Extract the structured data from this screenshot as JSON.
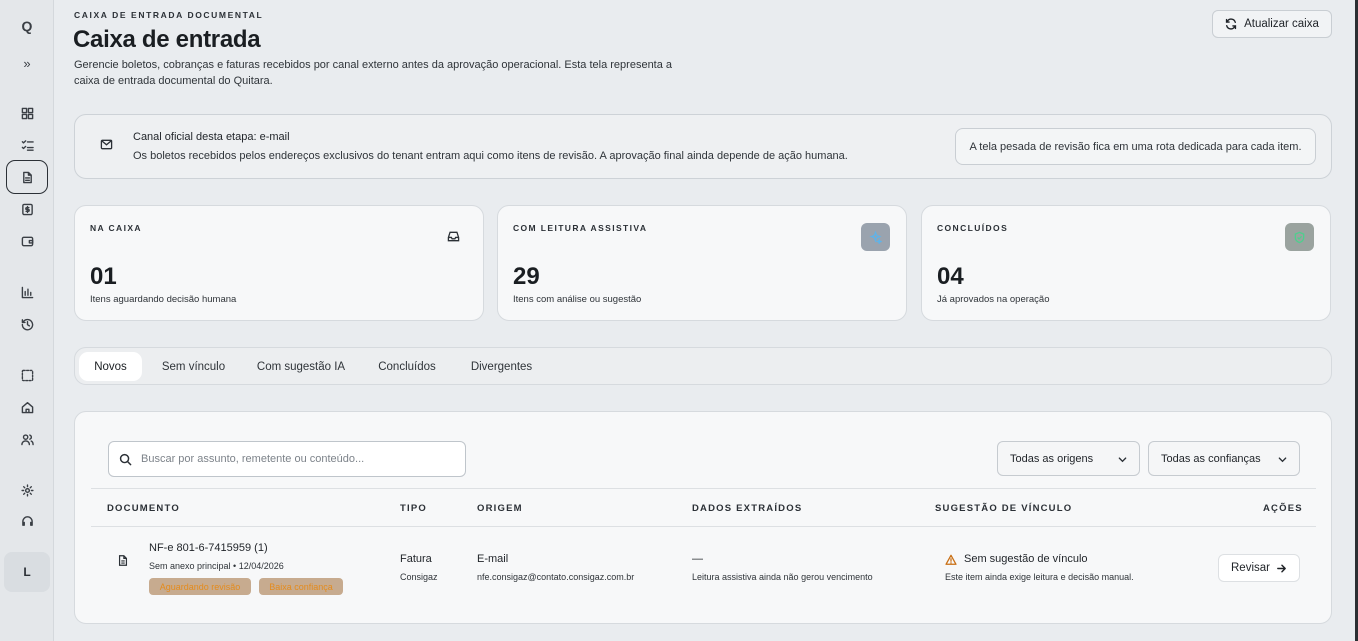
{
  "sidebar": {
    "logo": "Q",
    "expand_label": "»",
    "user_initial": "L",
    "items": [
      {
        "name": "dashboard",
        "icon": "grid-icon"
      },
      {
        "name": "tasks",
        "icon": "checklist-icon"
      },
      {
        "name": "documents",
        "icon": "document-icon",
        "active": true
      },
      {
        "name": "billing",
        "icon": "dollar-icon"
      },
      {
        "name": "wallet",
        "icon": "wallet-icon"
      },
      {
        "name": "reports",
        "icon": "bar-chart-icon"
      },
      {
        "name": "history",
        "icon": "history-icon"
      },
      {
        "name": "scan",
        "icon": "dashed-square-icon"
      },
      {
        "name": "home",
        "icon": "home-icon"
      },
      {
        "name": "users",
        "icon": "users-icon"
      },
      {
        "name": "settings",
        "icon": "gear-icon"
      },
      {
        "name": "support",
        "icon": "headset-icon"
      }
    ]
  },
  "header": {
    "eyebrow": "CAIXA DE ENTRADA DOCUMENTAL",
    "title": "Caixa de entrada",
    "description": "Gerencie boletos, cobranças e faturas recebidos por canal externo antes da aprovação operacional. Esta tela representa a caixa de entrada documental do Quitara.",
    "refresh_label": "Atualizar caixa"
  },
  "notice": {
    "title": "Canal oficial desta etapa: e-mail",
    "text": "Os boletos recebidos pelos endereços exclusivos do tenant entram aqui como itens de revisão. A aprovação final ainda depende de ação humana.",
    "pill": "A tela pesada de revisão fica em uma rota dedicada para cada item."
  },
  "stats": [
    {
      "label": "NA CAIXA",
      "value": "01",
      "sub": "Itens aguardando decisão humana",
      "icon": "inbox-icon"
    },
    {
      "label": "COM LEITURA ASSISTIVA",
      "value": "29",
      "sub": "Itens com análise ou sugestão",
      "icon": "sparkle-icon",
      "icon_bg": "#9aa3ae",
      "icon_color": "#5fb3e8"
    },
    {
      "label": "CONCLUÍDOS",
      "value": "04",
      "sub": "Já aprovados na operação",
      "icon": "shield-check-icon",
      "icon_bg": "#9aa39f",
      "icon_color": "#4fcf8e"
    }
  ],
  "tabs": [
    {
      "label": "Novos",
      "active": true
    },
    {
      "label": "Sem vínculo"
    },
    {
      "label": "Com sugestão IA"
    },
    {
      "label": "Concluídos"
    },
    {
      "label": "Divergentes"
    }
  ],
  "filters": {
    "search_placeholder": "Buscar por assunto, remetente ou conteúdo...",
    "origin_selected": "Todas as origens",
    "confidence_selected": "Todas as confianças"
  },
  "table": {
    "columns": [
      "DOCUMENTO",
      "TIPO",
      "ORIGEM",
      "DADOS EXTRAÍDOS",
      "SUGESTÃO DE VÍNCULO",
      "AÇÕES"
    ],
    "rows": [
      {
        "doc_title": "NF-e 801-6-7415959 (1)",
        "doc_sub": "Sem anexo principal • 12/04/2026",
        "badges": [
          "Aguardando revisão",
          "Baixa confiança"
        ],
        "type": "Fatura",
        "type_sub": "Consigaz",
        "origin": "E-mail",
        "origin_sub": "nfe.consigaz@contato.consigaz.com.br",
        "extracted": "—",
        "extracted_sub": "Leitura assistiva ainda não gerou vencimento",
        "suggestion": "Sem sugestão de vínculo",
        "suggestion_sub": "Este item ainda exige leitura e decisão manual.",
        "action": "Revisar"
      }
    ]
  }
}
